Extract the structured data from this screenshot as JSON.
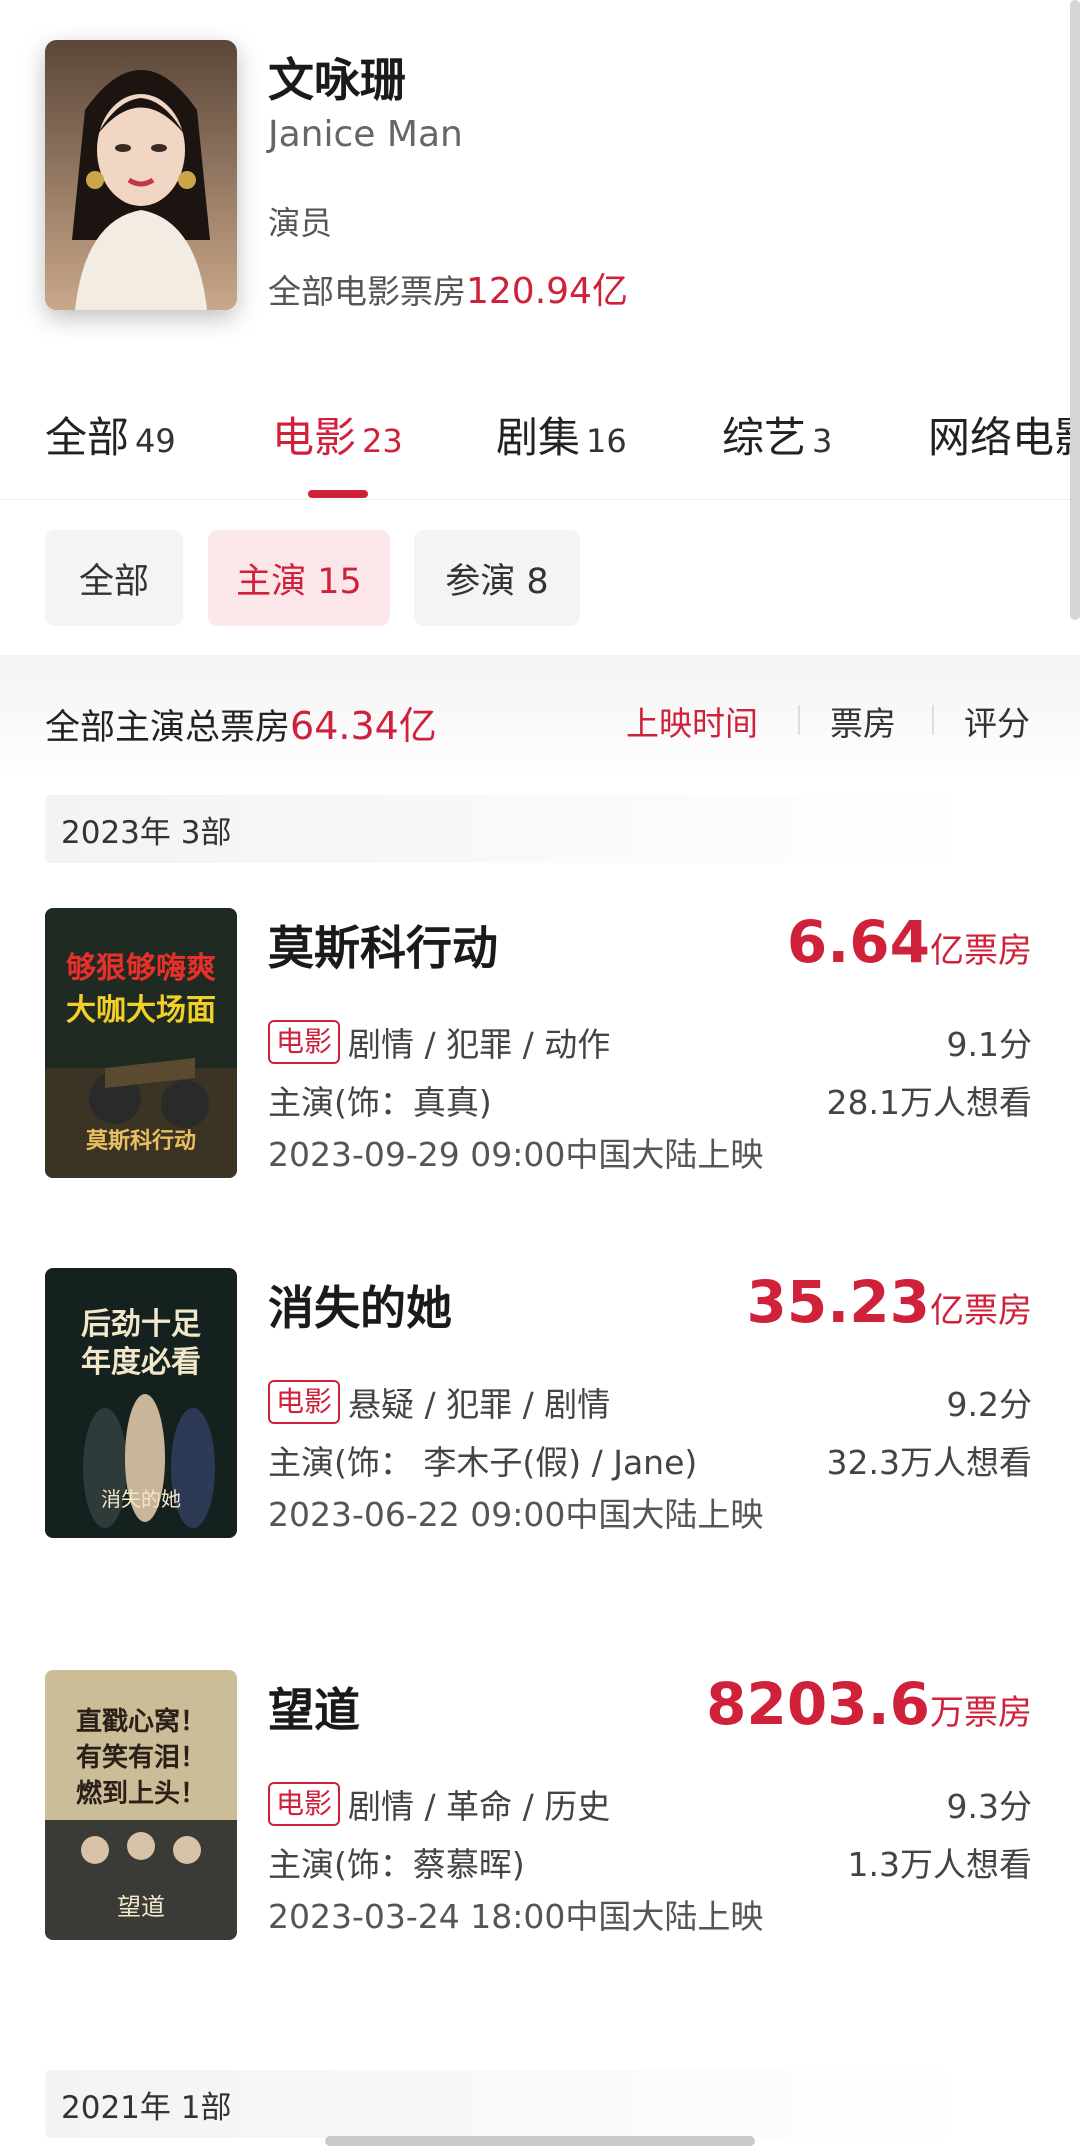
{
  "profile": {
    "name": "文咏珊",
    "name_en": "Janice Man",
    "role": "演员",
    "box_label": "全部电影票房",
    "box_value": "120.94亿"
  },
  "tabs": [
    {
      "label": "全部",
      "count": "49"
    },
    {
      "label": "电影",
      "count": "23"
    },
    {
      "label": "剧集",
      "count": "16"
    },
    {
      "label": "综艺",
      "count": "3"
    },
    {
      "label": "网络电影",
      "count": ""
    }
  ],
  "chips": [
    {
      "label": "全部"
    },
    {
      "label": "主演 15"
    },
    {
      "label": "参演 8"
    }
  ],
  "total": {
    "label": "全部主演总票房",
    "value": "64.34亿"
  },
  "sort": [
    "上映时间",
    "票房",
    "评分"
  ],
  "years": [
    {
      "label": "2023年  3部"
    },
    {
      "label": "2021年  1部"
    }
  ],
  "movies": [
    {
      "title": "莫斯科行动",
      "box_num": "6.64",
      "box_unit": "亿票房",
      "tag": "电影",
      "genres": "剧情 / 犯罪 / 动作",
      "rating": "9.1分",
      "cast": "主演(饰：真真)",
      "wants": "28.1万人想看",
      "date": "2023-09-29 09:00中国大陆上映",
      "poster_text": "够狠够嗨爽 大咖大场面"
    },
    {
      "title": "消失的她",
      "box_num": "35.23",
      "box_unit": "亿票房",
      "tag": "电影",
      "genres": "悬疑 / 犯罪 / 剧情",
      "rating": "9.2分",
      "cast": "主演(饰：  李木子(假) / Jane)",
      "wants": "32.3万人想看",
      "date": "2023-06-22 09:00中国大陆上映",
      "poster_text": "后劲十足 年度必看"
    },
    {
      "title": "望道",
      "box_num": "8203.6",
      "box_unit": "万票房",
      "tag": "电影",
      "genres": "剧情 / 革命 / 历史",
      "rating": "9.3分",
      "cast": "主演(饰：蔡慕晖)",
      "wants": "1.3万人想看",
      "date": "2023-03-24 18:00中国大陆上映",
      "poster_text": "直戳心窝！有笑有泪！燃到上头！"
    }
  ],
  "colors": {
    "accent": "#d0213b",
    "chip_bg": "#f4f4f4",
    "chip_active_bg": "#fbe7ea"
  }
}
